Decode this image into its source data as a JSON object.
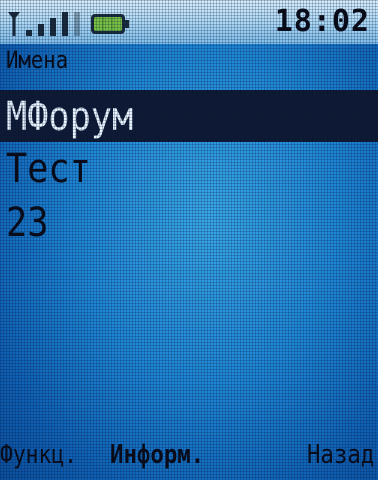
{
  "status": {
    "time": "18:02",
    "signal_icon": "signal-bars-icon",
    "battery_icon": "battery-icon"
  },
  "header": {
    "label": "Имена"
  },
  "list": {
    "items": [
      {
        "label": "МФорум",
        "selected": true
      },
      {
        "label": "Тест",
        "selected": false
      },
      {
        "label": "23",
        "selected": false
      }
    ]
  },
  "softkeys": {
    "left": "Функц.",
    "center": "Информ.",
    "right": "Назад"
  },
  "colors": {
    "background": "#1f86d4",
    "selection": "#0f1a33",
    "status_bar": "#a9d6f3"
  }
}
